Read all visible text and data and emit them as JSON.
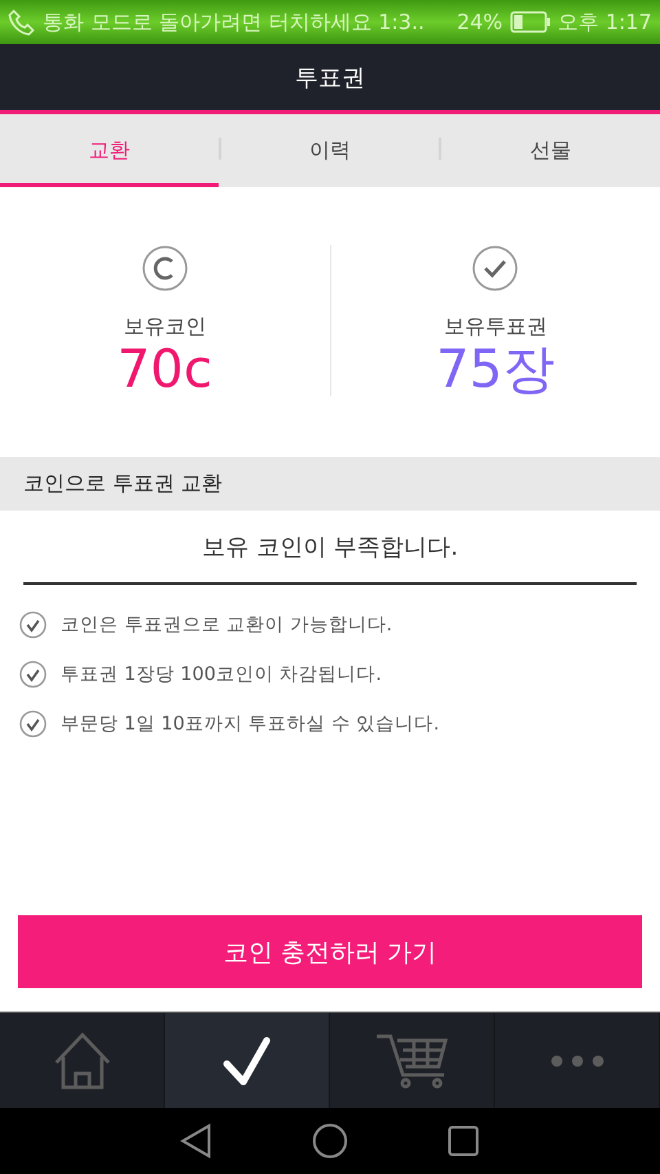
{
  "status_bar": {
    "notice": "통화 모드로 돌아가려면 터치하세요 1:3..",
    "battery": "24%",
    "time": "오후 1:17"
  },
  "header": {
    "title": "투표권"
  },
  "tabs": [
    {
      "label": "교환",
      "selected": true
    },
    {
      "label": "이력",
      "selected": false
    },
    {
      "label": "선물",
      "selected": false
    }
  ],
  "stats": [
    {
      "kind": "coin",
      "label": "보유코인",
      "value": "70c",
      "color": "#f0186e"
    },
    {
      "kind": "ticket",
      "label": "보유투표권",
      "value": "75장",
      "color": "#8066f5"
    }
  ],
  "section": {
    "title": "코인으로 투표권 교환"
  },
  "message": "보유 코인이 부족합니다.",
  "notes": [
    "코인은 투표권으로 교환이 가능합니다.",
    "투표권 1장당 100코인이 차감됩니다.",
    "부문당 1일 10표까지 투표하실 수 있습니다."
  ],
  "charge_button": "코인 충전하러 가기",
  "bottom_nav": [
    {
      "kind": "home",
      "selected": false
    },
    {
      "kind": "check",
      "selected": true
    },
    {
      "kind": "cart",
      "selected": false
    },
    {
      "kind": "more",
      "selected": false
    }
  ]
}
